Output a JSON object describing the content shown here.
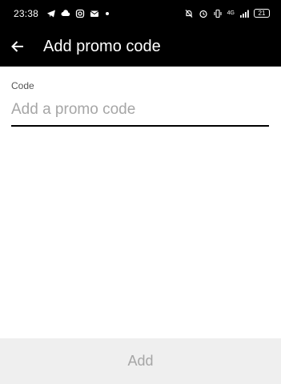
{
  "status_bar": {
    "time": "23:38",
    "left_icons": [
      "telegram-icon",
      "cloud-icon",
      "instagram-icon",
      "outlook-icon",
      "notification-dot-icon"
    ],
    "right_icons": [
      "bell-off-icon",
      "alarm-icon",
      "vibrate-icon",
      "signal-icon"
    ],
    "network_label": "4G",
    "battery": "21"
  },
  "title_bar": {
    "back_icon": "arrow-left-icon",
    "title": "Add promo code"
  },
  "form": {
    "code_label": "Code",
    "code_value": "",
    "code_placeholder": "Add a promo code"
  },
  "footer": {
    "add_label": "Add",
    "add_enabled": false
  },
  "colors": {
    "header_bg": "#000000",
    "header_text": "#ffffff",
    "placeholder": "#a6a6a6",
    "button_bg": "#efefef",
    "button_text_disabled": "#a6a6a6"
  }
}
